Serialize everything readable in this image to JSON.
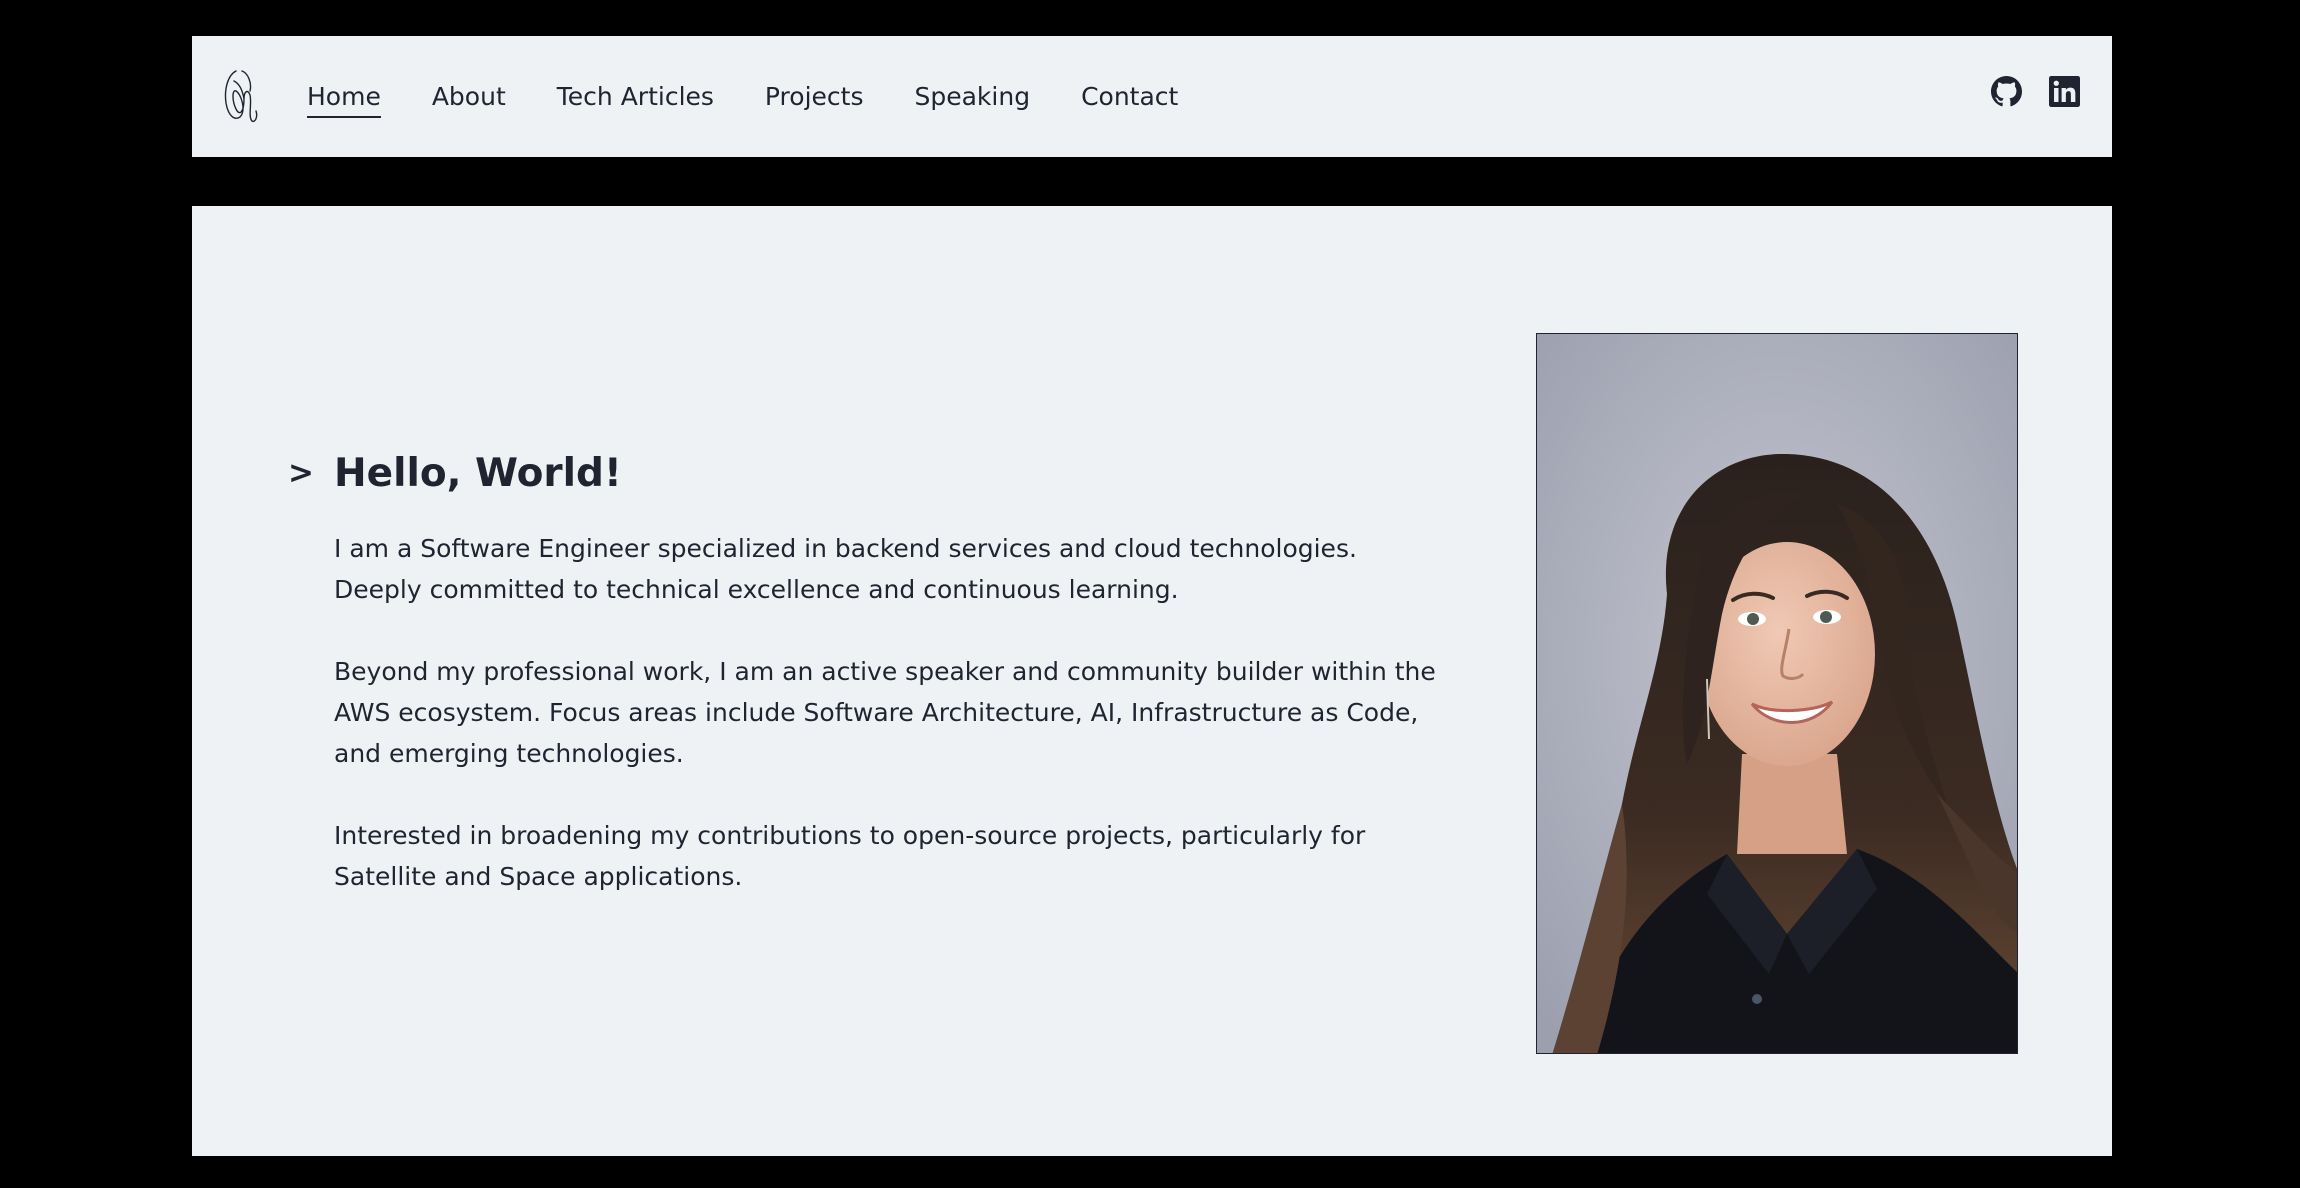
{
  "nav": {
    "logo_icon": "signature-logo-icon",
    "links": [
      {
        "label": "Home",
        "active": true
      },
      {
        "label": "About",
        "active": false
      },
      {
        "label": "Tech Articles",
        "active": false
      },
      {
        "label": "Projects",
        "active": false
      },
      {
        "label": "Speaking",
        "active": false
      },
      {
        "label": "Contact",
        "active": false
      }
    ],
    "social": [
      {
        "icon": "github-icon"
      },
      {
        "icon": "linkedin-icon"
      }
    ]
  },
  "intro": {
    "prompt": ">",
    "heading": "Hello, World!",
    "paragraphs": [
      "I am a Software Engineer specialized in backend services and cloud technologies. Deeply committed to technical excellence and continuous learning.",
      "Beyond my professional work, I am an active speaker and community builder within the AWS ecosystem. Focus areas include Software Architecture, AI, Infrastructure as Code, and emerging technologies.",
      "Interested in broadening my contributions to open-source projects, particularly for Satellite and Space applications."
    ]
  },
  "portrait": {
    "subject": "profile-photo"
  },
  "colors": {
    "page_background": "#000000",
    "panel_background": "#eef2f5",
    "text": "#1f2430"
  }
}
